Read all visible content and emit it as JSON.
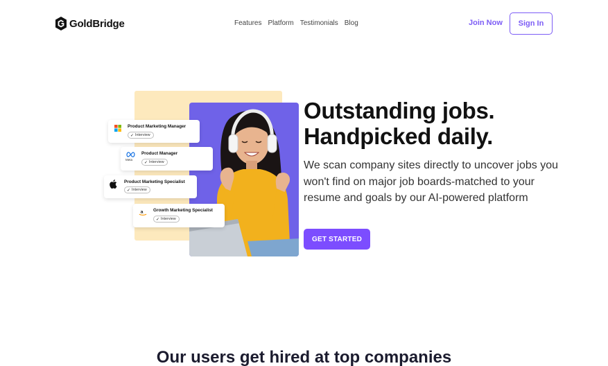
{
  "header": {
    "brand": "GoldBridge",
    "nav": [
      "Features",
      "Platform",
      "Testimonials",
      "Blog"
    ],
    "join_label": "Join Now",
    "signin_label": "Sign In"
  },
  "hero": {
    "headline_line1": "Outstanding jobs.",
    "headline_line2": "Handpicked daily.",
    "subtext": "We scan company sites directly to uncover jobs you won't find on major job boards-matched to your resume and goals by our AI-powered platform",
    "cta_label": "GET STARTED",
    "accent_color": "#7c4dff",
    "panel_color": "#fde9bd",
    "photo_bg_color": "#6f62e8",
    "job_cards": [
      {
        "title": "Product Marketing Manager",
        "status": "Interview",
        "logo": "microsoft-icon"
      },
      {
        "title": "Product Manager",
        "status": "Interview",
        "logo": "meta-icon",
        "logo_caption": "Meta"
      },
      {
        "title": "Product Marketing Specialist",
        "status": "Interview",
        "logo": "apple-icon"
      },
      {
        "title": "Growth Marketing Specialist",
        "status": "Interview",
        "logo": "amazon-icon"
      }
    ]
  },
  "companies": {
    "title": "Our users get hired at top companies"
  }
}
